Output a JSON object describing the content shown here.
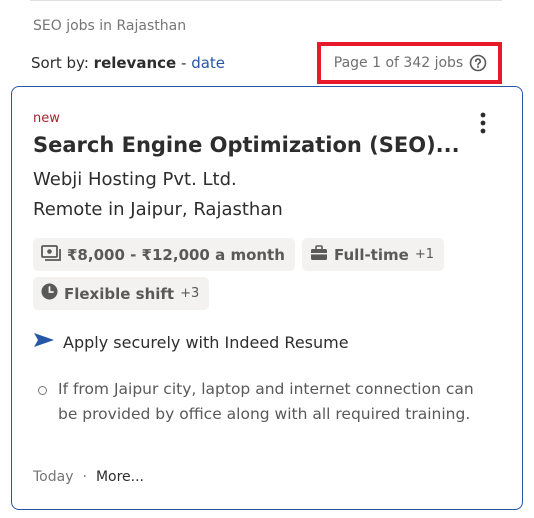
{
  "search": {
    "heading": "SEO jobs in Rajasthan"
  },
  "sort": {
    "label": "Sort by:",
    "active": "relevance",
    "separator": "-",
    "other": "date"
  },
  "pagination": {
    "text": "Page 1 of 342 jobs"
  },
  "job": {
    "badge": "new",
    "title": "Search Engine Optimization (SEO)...",
    "company": "Webji Hosting Pvt. Ltd.",
    "location": "Remote in Jaipur, Rajasthan",
    "salary": "₹8,000 - ₹12,000 a month",
    "job_type": "Full-time",
    "job_type_extra": "+1",
    "shift": "Flexible shift",
    "shift_extra": "+3",
    "apply_text": "Apply securely with Indeed Resume",
    "snippet": "If from Jaipur city, laptop and internet connection can be provided by office along with all required training.",
    "posted": "Today",
    "dot": "·",
    "more": "More..."
  },
  "colors": {
    "accent": "#2557a7",
    "highlight_border": "#e8192c",
    "new_badge": "#a9252b"
  }
}
